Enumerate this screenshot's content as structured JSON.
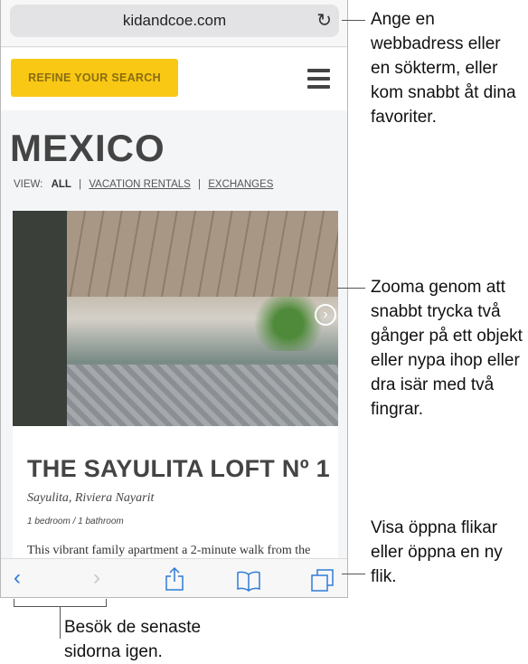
{
  "browser": {
    "url": "kidandcoe.com",
    "reload_icon": "reload-icon"
  },
  "site": {
    "refine_label": "REFINE YOUR SEARCH",
    "title": "MEXICO",
    "view_label": "VIEW:",
    "view_all": "ALL",
    "view_rentals": "VACATION RENTALS",
    "view_exchanges": "EXCHANGES",
    "separator": "|"
  },
  "listing": {
    "title": "THE SAYULITA LOFT Nº 1",
    "location": "Sayulita, Riviera Nayarit",
    "rooms": "1 bedroom / 1 bathroom",
    "description": "This vibrant family apartment a 2-minute walk from the"
  },
  "toolbar": {
    "accent": "#2f7bd8"
  },
  "callouts": {
    "address": "Ange en webbadress eller en sökterm, eller kom snabbt åt dina favoriter.",
    "zoom": "Zooma genom att snabbt trycka två gånger på ett objekt eller nypa ihop eller dra isär med två fingrar.",
    "tabs": "Visa öppna flikar eller öppna en ny flik.",
    "history": "Besök de senaste sidorna igen."
  }
}
